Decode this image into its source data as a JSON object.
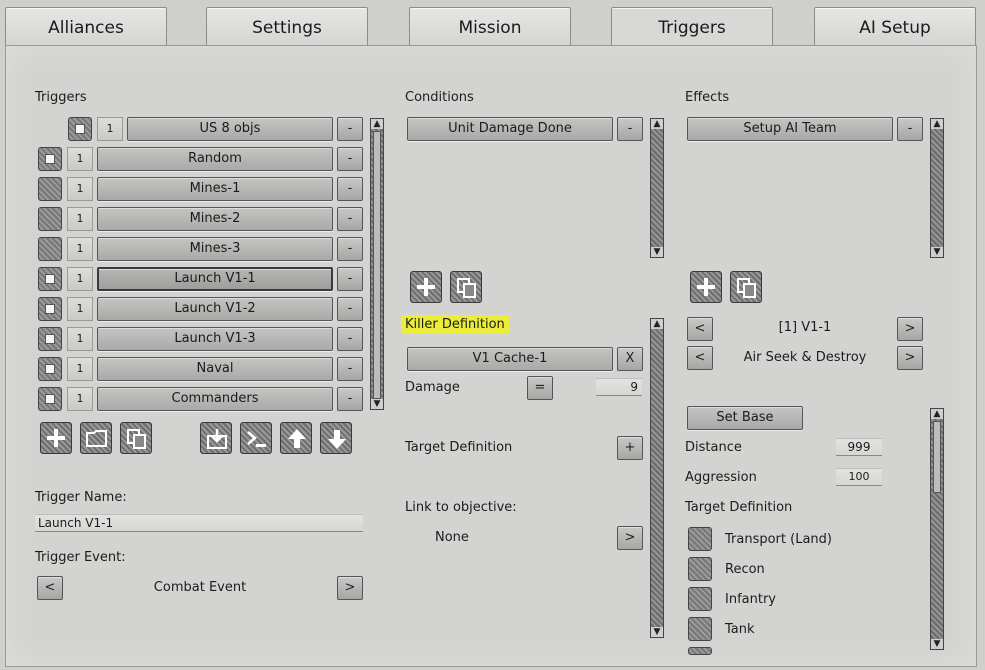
{
  "tabs": [
    "Alliances",
    "Settings",
    "Mission",
    "Triggers",
    "AI Setup"
  ],
  "active_tab": "Triggers",
  "triggers": {
    "title": "Triggers",
    "items": [
      {
        "count": "1",
        "label": "US 8 objs",
        "checked": true
      },
      {
        "count": "1",
        "label": "Random",
        "checked": true
      },
      {
        "count": "1",
        "label": "Mines-1",
        "checked": false
      },
      {
        "count": "1",
        "label": "Mines-2",
        "checked": false
      },
      {
        "count": "1",
        "label": "Mines-3",
        "checked": false
      },
      {
        "count": "1",
        "label": "Launch V1-1",
        "checked": true,
        "selected": true
      },
      {
        "count": "1",
        "label": "Launch V1-2",
        "checked": true
      },
      {
        "count": "1",
        "label": "Launch V1-3",
        "checked": true
      },
      {
        "count": "1",
        "label": "Naval",
        "checked": true
      },
      {
        "count": "1",
        "label": "Commanders",
        "checked": true
      }
    ],
    "remove_label": "-",
    "trigger_name_label": "Trigger Name:",
    "trigger_name_value": "Launch V1-1",
    "trigger_event_label": "Trigger Event:",
    "trigger_event_value": "Combat Event",
    "prev": "<",
    "next": ">"
  },
  "conditions": {
    "title": "Conditions",
    "items": [
      "Unit Damage Done"
    ],
    "remove_label": "-",
    "killer_definition_label": "Killer Definition",
    "killer_value": "V1 Cache-1",
    "killer_clear": "X",
    "damage_label": "Damage",
    "damage_operator": "=",
    "damage_value": "9",
    "target_definition_label": "Target Definition",
    "target_add": "+",
    "link_label": "Link to objective:",
    "link_value": "None",
    "link_next": ">"
  },
  "effects": {
    "title": "Effects",
    "items": [
      "Setup AI Team"
    ],
    "remove_label": "-",
    "team_value": "[1] V1-1",
    "order_value": "Air Seek & Destroy",
    "prev": "<",
    "next": ">",
    "set_base_label": "Set Base",
    "distance_label": "Distance",
    "distance_value": "999",
    "aggression_label": "Aggression",
    "aggression_value": "100",
    "target_definition_label": "Target Definition",
    "targets": [
      "Transport (Land)",
      "Recon",
      "Infantry",
      "Tank"
    ]
  },
  "icons": {
    "add": "plus-icon",
    "folder": "folder-icon",
    "copy": "copy-icon",
    "import": "import-icon",
    "console": "console-icon",
    "move_up": "arrow-up-icon",
    "move_down": "arrow-down-icon"
  },
  "colors": {
    "highlight": "#ecec3a",
    "panel": "#d3d3d1"
  }
}
